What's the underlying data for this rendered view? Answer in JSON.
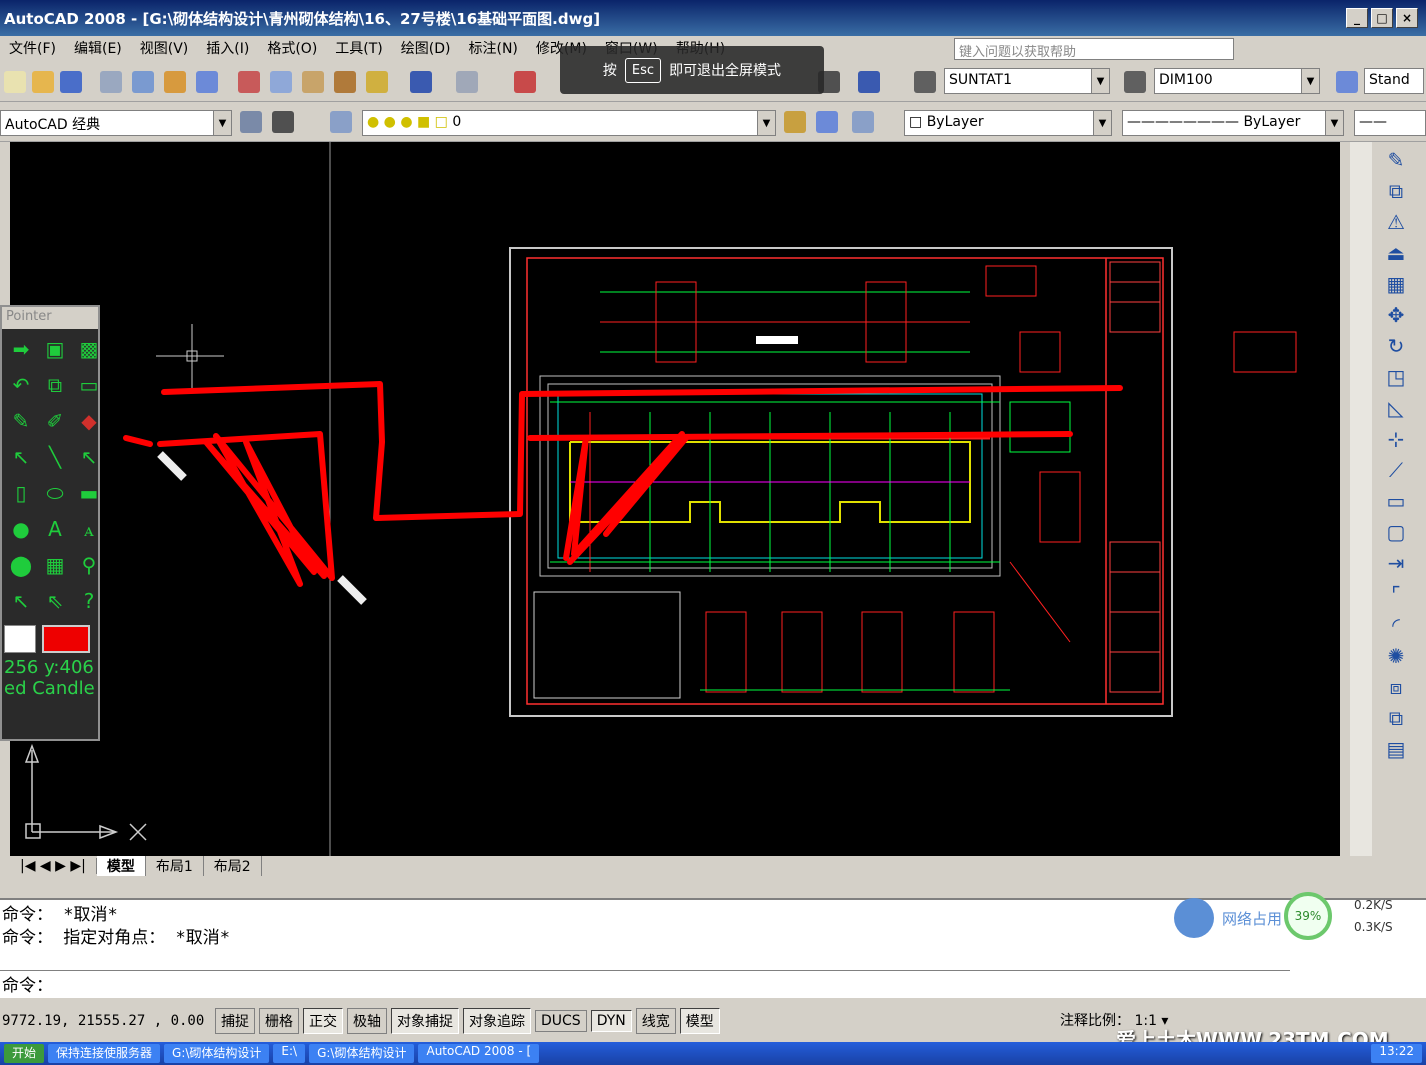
{
  "window": {
    "title": "AutoCAD 2008 - [G:\\砌体结构设计\\青州砌体结构\\16、27号楼\\16基础平面图.dwg]",
    "min": "_",
    "max": "□",
    "close": "×"
  },
  "menu": [
    "文件(F)",
    "编辑(E)",
    "视图(V)",
    "插入(I)",
    "格式(O)",
    "工具(T)",
    "绘图(D)",
    "标注(N)",
    "修改(M)",
    "窗口(W)",
    "帮助(H)"
  ],
  "help_placeholder": "键入问题以获取帮助",
  "fullscreen": {
    "prefix": "按",
    "key": "Esc",
    "suffix": "即可退出全屏模式"
  },
  "toolbar": {
    "text_style": "SUNTAT1",
    "dim_style": "DIM100",
    "table_style": "Stand",
    "workspace": "AutoCAD 经典",
    "layer": "0",
    "color": "ByLayer",
    "linetype": "ByLayer"
  },
  "pointer_panel": {
    "title": "Pointer",
    "coords": "256  y:406",
    "label": "ed Candle"
  },
  "tabs": [
    "模型",
    "布局1",
    "布局2"
  ],
  "command": {
    "history": [
      "命令： *取消*",
      "命令： 指定对角点： *取消*"
    ],
    "prompt": "命令："
  },
  "status": {
    "coords": "9772.19, 21555.27 , 0.00",
    "buttons": [
      "捕捉",
      "栅格",
      "正交",
      "极轴",
      "对象捕捉",
      "对象追踪",
      "DUCS",
      "DYN",
      "线宽",
      "模型"
    ],
    "annotation_scale": "注释比例： 1:1 ▾"
  },
  "network": {
    "label": "网络占用",
    "percent": "39%",
    "up": "0.2K/S",
    "down": "0.3K/S"
  },
  "watermark": "爱上土木WWW.23TM.COM",
  "taskbar": [
    "开始",
    "保持连接使服务器",
    "G:\\砌体结构设计",
    "E:\\",
    "G:\\砌体结构设计",
    "AutoCAD 2008 - [",
    "13:22"
  ]
}
